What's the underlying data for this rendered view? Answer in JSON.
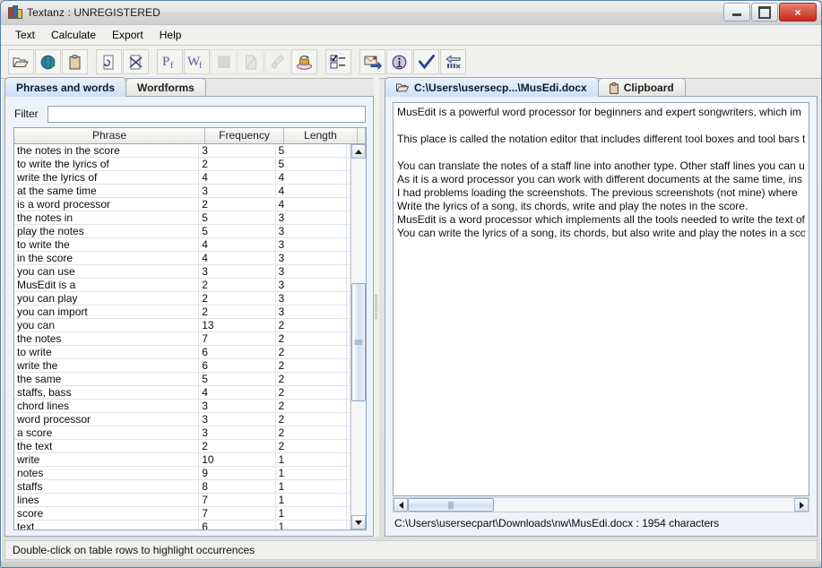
{
  "window": {
    "title": "Textanz : UNREGISTERED",
    "icon": "books-icon",
    "buttons": {
      "minimize": "minimize-icon",
      "maximize": "maximize-icon",
      "close": "×"
    }
  },
  "menubar": {
    "items": [
      {
        "label": "Text"
      },
      {
        "label": "Calculate"
      },
      {
        "label": "Export"
      },
      {
        "label": "Help"
      }
    ]
  },
  "toolbar": {
    "groups": [
      {
        "buttons": [
          {
            "name": "open-file-icon",
            "tooltip": "Open file"
          },
          {
            "name": "open-web-icon",
            "tooltip": "Open web page"
          },
          {
            "name": "paste-clipboard-icon",
            "tooltip": "Paste from clipboard"
          }
        ]
      },
      {
        "buttons": [
          {
            "name": "reload-document-icon",
            "tooltip": "Reload"
          },
          {
            "name": "close-document-icon",
            "tooltip": "Close document"
          }
        ]
      },
      {
        "buttons": [
          {
            "name": "phrase-frequency-icon",
            "tooltip": "Phrase frequency"
          },
          {
            "name": "word-frequency-icon",
            "tooltip": "Word frequency"
          },
          {
            "name": "stop-icon",
            "tooltip": "Stop",
            "disabled": true
          },
          {
            "name": "clear-document-icon",
            "tooltip": "Clear",
            "disabled": true
          },
          {
            "name": "clear-all-icon",
            "tooltip": "Clear all",
            "disabled": true
          },
          {
            "name": "stemming-icon",
            "tooltip": "Stemming"
          }
        ]
      },
      {
        "buttons": [
          {
            "name": "select-list-icon",
            "tooltip": "Selection options"
          }
        ]
      },
      {
        "buttons": [
          {
            "name": "export-icon",
            "tooltip": "Export"
          },
          {
            "name": "info-icon",
            "tooltip": "Information"
          },
          {
            "name": "check-icon",
            "tooltip": "Apply"
          },
          {
            "name": "back-references-icon",
            "tooltip": "Back"
          }
        ]
      }
    ]
  },
  "left_panel": {
    "tabs": [
      {
        "label": "Phrases and words",
        "active": true
      },
      {
        "label": "Wordforms",
        "active": false
      }
    ],
    "filter": {
      "label": "Filter",
      "value": "",
      "placeholder": ""
    },
    "table": {
      "columns": [
        "Phrase",
        "Frequency",
        "Length"
      ],
      "rows": [
        [
          "the notes in the score",
          "3",
          "5"
        ],
        [
          "to write the lyrics of",
          "2",
          "5"
        ],
        [
          "write the lyrics of",
          "4",
          "4"
        ],
        [
          "at the same time",
          "3",
          "4"
        ],
        [
          "is a word processor",
          "2",
          "4"
        ],
        [
          "the notes in",
          "5",
          "3"
        ],
        [
          "play the notes",
          "5",
          "3"
        ],
        [
          "to write the",
          "4",
          "3"
        ],
        [
          "in the score",
          "4",
          "3"
        ],
        [
          "you can use",
          "3",
          "3"
        ],
        [
          "MusEdit is a",
          "2",
          "3"
        ],
        [
          "you can play",
          "2",
          "3"
        ],
        [
          "you can import",
          "2",
          "3"
        ],
        [
          "you can",
          "13",
          "2"
        ],
        [
          "the notes",
          "7",
          "2"
        ],
        [
          "to write",
          "6",
          "2"
        ],
        [
          "write the",
          "6",
          "2"
        ],
        [
          "the same",
          "5",
          "2"
        ],
        [
          "staffs, bass",
          "4",
          "2"
        ],
        [
          "chord lines",
          "3",
          "2"
        ],
        [
          "word processor",
          "3",
          "2"
        ],
        [
          "a score",
          "3",
          "2"
        ],
        [
          "the text",
          "2",
          "2"
        ],
        [
          "write",
          "10",
          "1"
        ],
        [
          "notes",
          "9",
          "1"
        ],
        [
          "staffs",
          "8",
          "1"
        ],
        [
          "lines",
          "7",
          "1"
        ],
        [
          "score",
          "7",
          "1"
        ],
        [
          "text",
          "6",
          "1"
        ]
      ]
    },
    "scrollbar": {
      "up": "scroll-up-icon",
      "down": "scroll-down-icon"
    }
  },
  "right_panel": {
    "tabs": [
      {
        "label": "C:\\Users\\usersecp...\\MusEdi.docx",
        "icon": "document-icon",
        "active": true
      },
      {
        "label": "Clipboard",
        "icon": "clipboard-icon",
        "active": false
      }
    ],
    "document": {
      "lines": [
        "MusEdit is a powerful word processor for beginners and expert songwriters, which im",
        "",
        "This place is called the notation editor that includes different tool boxes and tool bars t",
        "",
        "You can translate the notes of a staff line into another type. Other staff lines you can us",
        "As it is a word processor you can work with different documents at the same time, ins",
        "I had problems loading the screenshots. The previous screenshots (not mine) where",
        "Write the lyrics of a song, its chords, write and play the notes in the score.",
        "MusEdit is a word processor which implements all the tools needed to write the text of",
        "You can write the lyrics of a song, its chords, but also write and play the notes in a sco"
      ]
    },
    "status": "C:\\Users\\usersecpart\\Downloads\\nw\\MusEdi.docx : 1954 characters",
    "scrollbar": {
      "left": "scroll-left-icon",
      "right": "scroll-right-icon"
    }
  },
  "statusbar": {
    "text": "Double-click on table rows to highlight occurrences"
  },
  "colors": {
    "accent": "#cfe0f4",
    "tab_active": "#cfe0f4",
    "border": "#8ea2b8",
    "close_button": "#c4281a",
    "panel_bg": "#eef3fa",
    "chrome_bg": "#f0f0ec"
  }
}
